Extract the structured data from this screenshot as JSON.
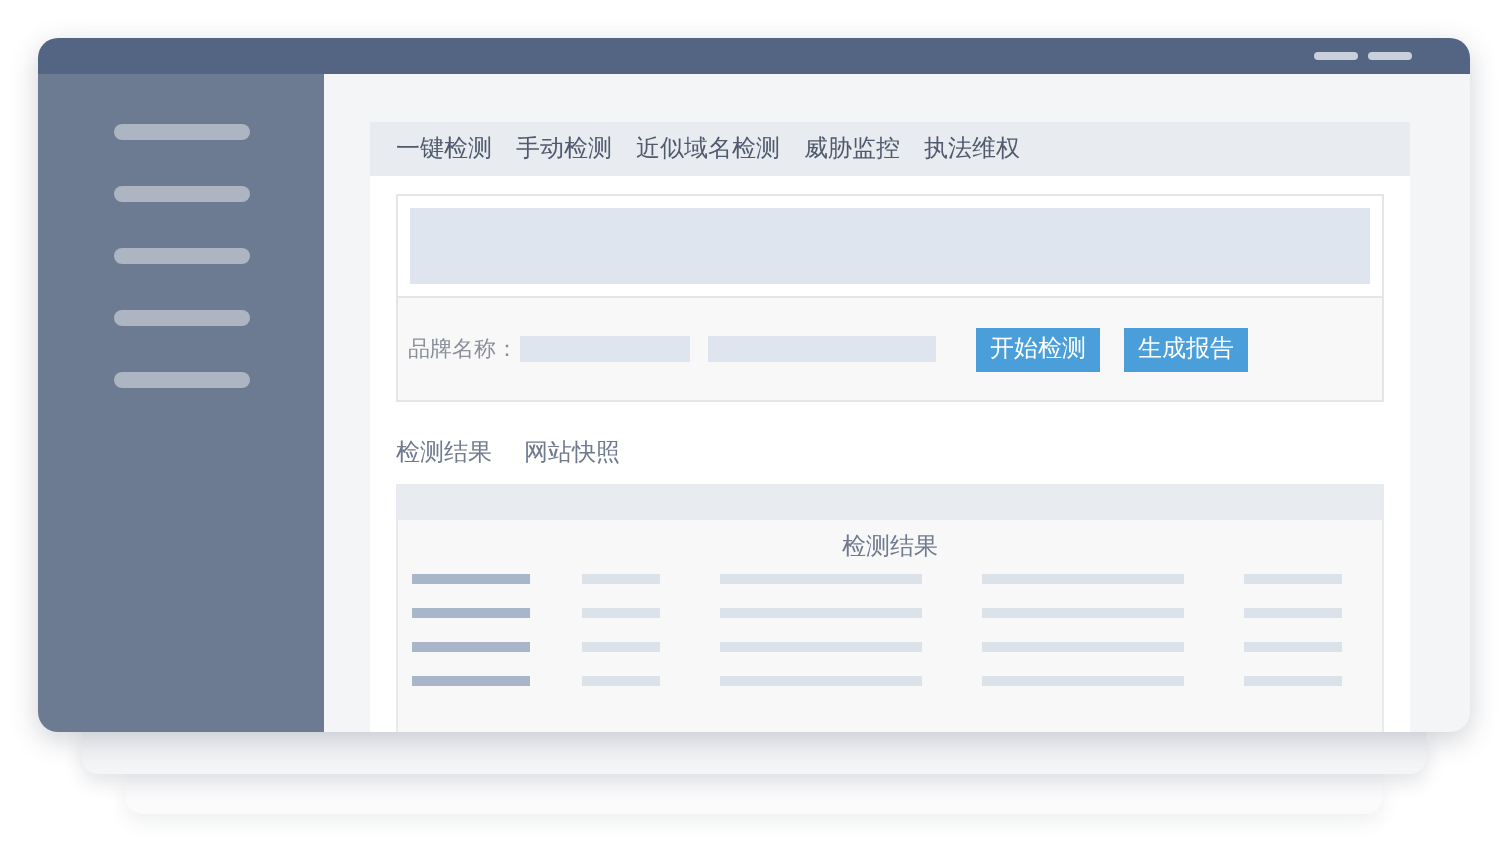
{
  "nav_tabs": [
    {
      "label": "一键检测"
    },
    {
      "label": "手动检测"
    },
    {
      "label": "近似域名检测"
    },
    {
      "label": "威胁监控"
    },
    {
      "label": "执法维权"
    }
  ],
  "brand_form": {
    "label": "品牌名称：",
    "buttons": [
      {
        "label": "开始检测"
      },
      {
        "label": "生成报告"
      }
    ]
  },
  "result_tabs": [
    {
      "label": "检测结果"
    },
    {
      "label": "网站快照"
    }
  ],
  "results": {
    "title": "检测结果"
  }
}
